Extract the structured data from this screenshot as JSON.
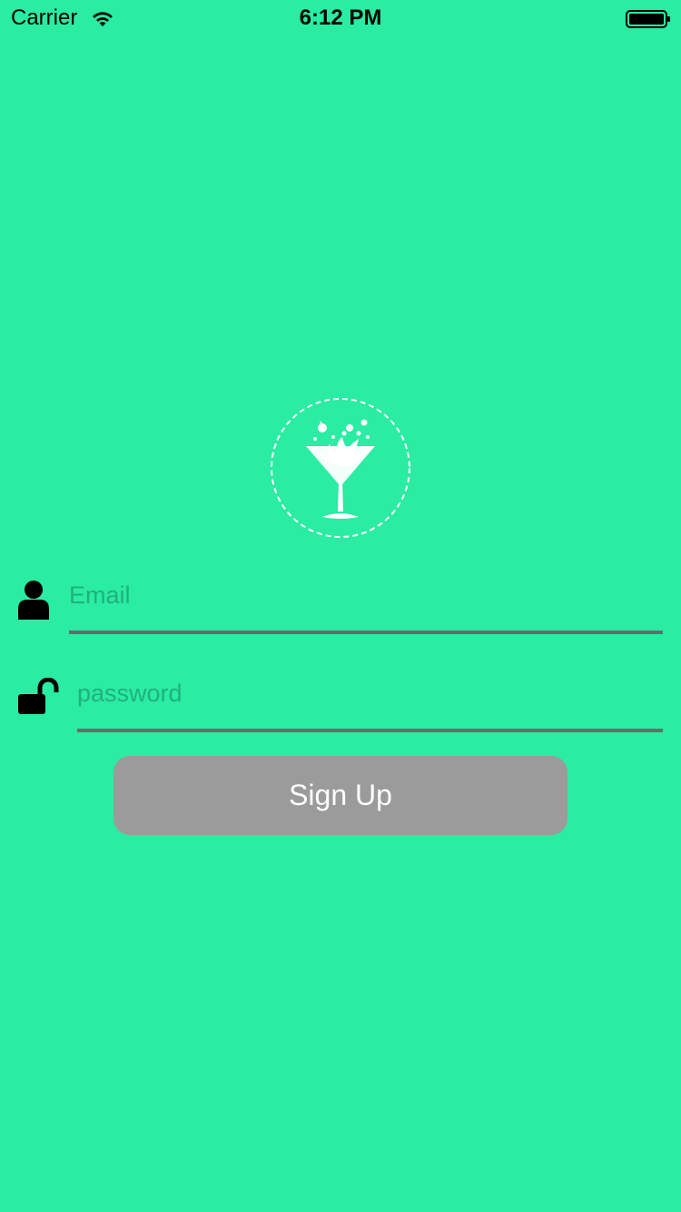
{
  "status_bar": {
    "carrier": "Carrier",
    "time": "6:12 PM"
  },
  "logo": {
    "icon": "cocktail-glass-icon"
  },
  "form": {
    "email_placeholder": "Email",
    "password_placeholder": "password",
    "signup_label": "Sign Up"
  },
  "colors": {
    "background": "#2aeca2",
    "button": "#9b9b9b",
    "underline": "#6b6b6b",
    "placeholder": "#22b07c"
  }
}
